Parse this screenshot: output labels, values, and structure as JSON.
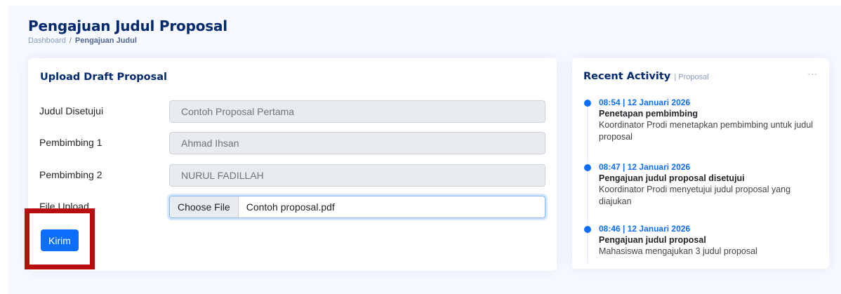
{
  "page": {
    "title": "Pengajuan Judul Proposal",
    "breadcrumb": {
      "home": "Dashboard",
      "separator": "/",
      "current": "Pengajuan Judul"
    }
  },
  "upload_card": {
    "title": "Upload Draft Proposal",
    "fields": [
      {
        "label": "Judul Disetujui",
        "value": "Contoh Proposal Pertama"
      },
      {
        "label": "Pembimbing 1",
        "value": "Ahmad Ihsan"
      },
      {
        "label": "Pembimbing 2",
        "value": "NURUL FADILLAH"
      }
    ],
    "file_field": {
      "label": "File Upload",
      "button_label": "Choose File",
      "file_name": "Contoh proposal.pdf"
    },
    "submit_label": "Kirim"
  },
  "activity_card": {
    "title": "Recent Activity",
    "subtitle": "| Proposal",
    "more_icon": "ellipsis-icon",
    "items": [
      {
        "time": "08:54 | 12 Januari 2026",
        "title": "Penetapan pembimbing",
        "description": "Koordinator Prodi menetapkan pembimbing untuk judul proposal"
      },
      {
        "time": "08:47 | 12 Januari 2026",
        "title": "Pengajuan judul proposal disetujui",
        "description": "Koordinator Prodi menyetujui judul proposal yang diajukan"
      },
      {
        "time": "08:46 | 12 Januari 2026",
        "title": "Pengajuan judul proposal",
        "description": "Mahasiswa mengajukan 3 judul proposal"
      }
    ]
  },
  "colors": {
    "primary": "#0d6efd",
    "heading": "#012970",
    "highlight": "#b80d0d",
    "background": "#f6f9ff"
  }
}
